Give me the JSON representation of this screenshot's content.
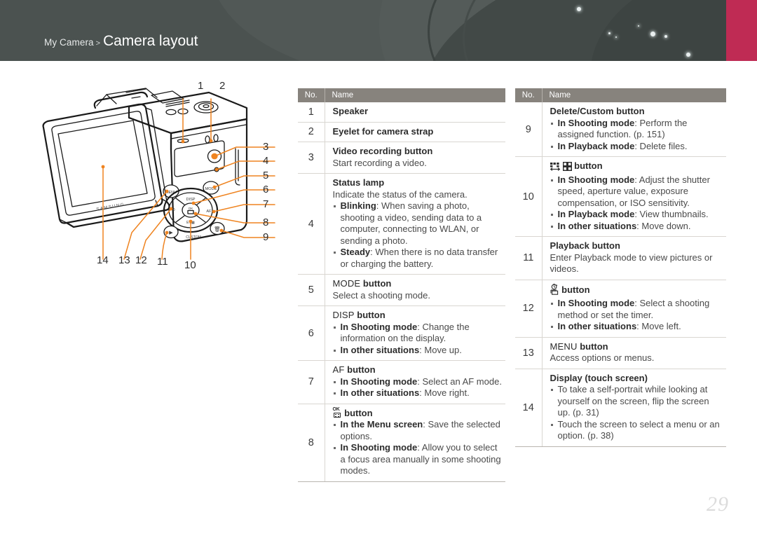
{
  "header": {
    "breadcrumb_parent": "My Camera",
    "breadcrumb_separator": ">",
    "title": "Camera layout",
    "bg_color": "#4b5250",
    "accent_color": "#bf2b54"
  },
  "illustration": {
    "brand_label": "SAMSUNG",
    "custom_label": "CUSTOM",
    "callouts": [
      "1",
      "2",
      "3",
      "4",
      "5",
      "6",
      "7",
      "8",
      "9",
      "10",
      "11",
      "12",
      "13",
      "14"
    ],
    "leader_color": "#ef8421"
  },
  "table_header": {
    "no": "No.",
    "name": "Name",
    "bg_color": "#87837d"
  },
  "left_table": {
    "rows": [
      {
        "no": "1",
        "title": "Speaker",
        "title_style": "bold",
        "desc": "",
        "bullets": []
      },
      {
        "no": "2",
        "title": "Eyelet for camera strap",
        "title_style": "bold",
        "desc": "",
        "bullets": []
      },
      {
        "no": "3",
        "title": "Video recording button",
        "title_style": "bold",
        "desc": "Start recording a video.",
        "bullets": []
      },
      {
        "no": "4",
        "title": "Status lamp",
        "title_style": "bold",
        "desc": "Indicate the status of the camera.",
        "bullets": [
          {
            "lead": "Blinking",
            "text": ": When saving a photo, shooting a video, sending data to a computer, connecting to WLAN, or sending a photo."
          },
          {
            "lead": "Steady",
            "text": ": When there is no data transfer or charging the battery."
          }
        ]
      },
      {
        "no": "5",
        "title": "MODE button",
        "title_style": "camfont",
        "title_cam": "MODE",
        "title_rest": " button",
        "desc": "Select a shooting mode.",
        "bullets": []
      },
      {
        "no": "6",
        "title": "DISP button",
        "title_style": "camfont",
        "title_cam": "DISP",
        "title_rest": " button",
        "desc": "",
        "bullets": [
          {
            "lead": "In Shooting mode",
            "text": ": Change the information on the display."
          },
          {
            "lead": "In other situations",
            "text": ": Move up."
          }
        ]
      },
      {
        "no": "7",
        "title": "AF button",
        "title_style": "camfont",
        "title_cam": "AF",
        "title_rest": " button",
        "desc": "",
        "bullets": [
          {
            "lead": "In Shooting mode",
            "text": ": Select an AF mode."
          },
          {
            "lead": "In other situations",
            "text": ": Move right."
          }
        ]
      },
      {
        "no": "8",
        "title": "button",
        "title_style": "icon-ok",
        "icon": "ok-button-icon",
        "title_rest": "button",
        "desc": "",
        "bullets": [
          {
            "lead": "In the Menu screen",
            "text": ": Save the selected options."
          },
          {
            "lead": "In Shooting mode",
            "text": ": Allow you to select a focus area manually in some shooting modes."
          }
        ]
      }
    ]
  },
  "right_table": {
    "rows": [
      {
        "no": "9",
        "title": "Delete/Custom button",
        "title_style": "bold",
        "desc": "",
        "bullets": [
          {
            "lead": "In Shooting mode",
            "text": ": Perform the assigned function. (p. 151)"
          },
          {
            "lead": "In Playback mode",
            "text": ": Delete files."
          }
        ]
      },
      {
        "no": "10",
        "title": "button",
        "title_style": "icon-ev-grid",
        "icon": "exposure-thumbnail-button-icon",
        "title_rest": "button",
        "desc": "",
        "bullets": [
          {
            "lead": "In Shooting mode",
            "text": ": Adjust the shutter speed, aperture value, exposure compensation, or ISO sensitivity."
          },
          {
            "lead": "In Playback mode",
            "text": ": View thumbnails."
          },
          {
            "lead": "In other situations",
            "text": ": Move down."
          }
        ]
      },
      {
        "no": "11",
        "title": "Playback button",
        "title_style": "bold",
        "desc": "Enter Playback mode to view pictures or videos.",
        "bullets": []
      },
      {
        "no": "12",
        "title": "button",
        "title_style": "icon-timer",
        "icon": "drive-timer-button-icon",
        "title_rest": "button",
        "desc": "",
        "bullets": [
          {
            "lead": "In Shooting mode",
            "text": ": Select a shooting method or set the timer."
          },
          {
            "lead": "In other situations",
            "text": ": Move left."
          }
        ]
      },
      {
        "no": "13",
        "title": "MENU button",
        "title_style": "camfont",
        "title_cam": "MENU",
        "title_rest": " button",
        "desc": "Access options or menus.",
        "bullets": []
      },
      {
        "no": "14",
        "title": "Display (touch screen)",
        "title_style": "bold",
        "desc": "",
        "bullets": [
          {
            "lead": "",
            "text": "To take a self-portrait while looking at yourself on the screen, flip the screen up. (p. 31)"
          },
          {
            "lead": "",
            "text": "Touch the screen to select a menu or an option. (p. 38)"
          }
        ]
      }
    ]
  },
  "footer": {
    "page_number": "29"
  }
}
